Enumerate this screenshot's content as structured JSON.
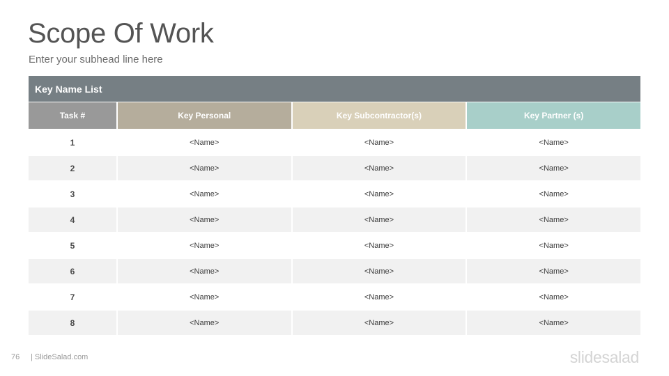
{
  "slide": {
    "title": "Scope Of Work",
    "subtitle": "Enter your subhead line here",
    "page_number": "76",
    "site": "| SlideSalad.com",
    "logo_text": "slidesalad"
  },
  "table": {
    "header": "Key Name List",
    "header_color": "#767f84",
    "columns": [
      {
        "label": "Task #",
        "color": "#999999"
      },
      {
        "label": "Key Personal",
        "color": "#b5ad9c"
      },
      {
        "label": "Key Subcontractor(s)",
        "color": "#d9d0b9"
      },
      {
        "label": "Key Partner (s)",
        "color": "#a8cfc9"
      }
    ],
    "rows": [
      {
        "task": "1",
        "personal": "<Name>",
        "subcontractor": "<Name>",
        "partner": "<Name>"
      },
      {
        "task": "2",
        "personal": "<Name>",
        "subcontractor": "<Name>",
        "partner": "<Name>"
      },
      {
        "task": "3",
        "personal": "<Name>",
        "subcontractor": "<Name>",
        "partner": "<Name>"
      },
      {
        "task": "4",
        "personal": "<Name>",
        "subcontractor": "<Name>",
        "partner": "<Name>"
      },
      {
        "task": "5",
        "personal": "<Name>",
        "subcontractor": "<Name>",
        "partner": "<Name>"
      },
      {
        "task": "6",
        "personal": "<Name>",
        "subcontractor": "<Name>",
        "partner": "<Name>"
      },
      {
        "task": "7",
        "personal": "<Name>",
        "subcontractor": "<Name>",
        "partner": "<Name>"
      },
      {
        "task": "8",
        "personal": "<Name>",
        "subcontractor": "<Name>",
        "partner": "<Name>"
      }
    ]
  }
}
